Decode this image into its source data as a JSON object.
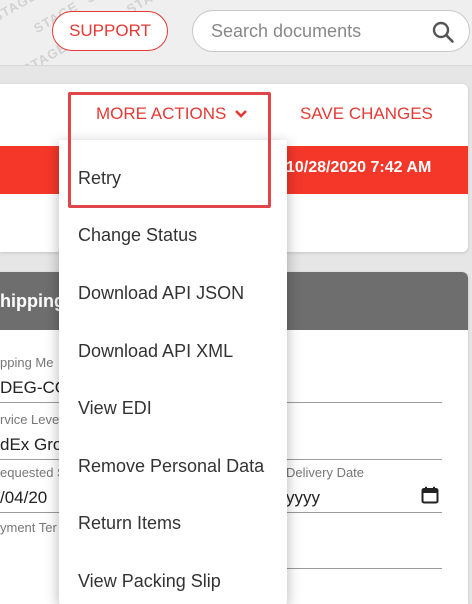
{
  "header": {
    "watermark": "STAGE",
    "support_label": "SUPPORT",
    "search_placeholder": "Search documents"
  },
  "toolbar": {
    "more_actions_label": "MORE ACTIONS",
    "save_changes_label": "SAVE CHANGES"
  },
  "status_bar": {
    "timestamp": "10/28/2020 7:42 AM",
    "color": "#f5372a"
  },
  "shipping_section": {
    "title": "hipping",
    "fields": [
      {
        "label": "pping Me",
        "value": "DEG-CG"
      },
      {
        "label": "rvice Leve",
        "value": "dEx Gro"
      },
      {
        "label": "equested S",
        "value": "/04/20"
      },
      {
        "label": "Delivery Date",
        "value": "yyyy"
      },
      {
        "label": "yment Ter",
        "value": ""
      }
    ]
  },
  "more_actions_menu": {
    "items": [
      "Retry",
      "Change Status",
      "Download API JSON",
      "Download API XML",
      "View EDI",
      "Remove Personal Data",
      "Return Items",
      "View Packing Slip"
    ]
  },
  "icons": {
    "search": "search-icon",
    "chevron": "chevron-down-icon",
    "calendar": "calendar-icon"
  },
  "colors": {
    "accent": "#e53935",
    "header_bg": "#6e6e6e"
  }
}
